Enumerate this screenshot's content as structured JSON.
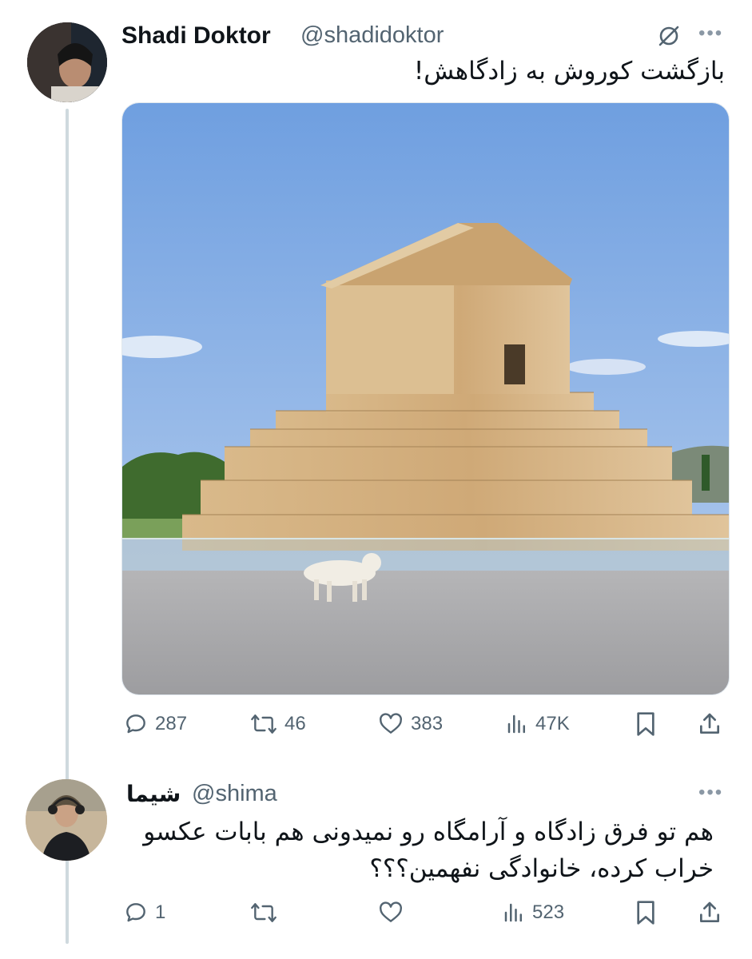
{
  "tweet": {
    "author_name": "Shadi Doktor",
    "author_handle": "@shadidoktor",
    "text": "بازگشت کوروش به زادگاهش!",
    "media_icon": "photo-tomb-of-cyrus",
    "actions": {
      "replies": "287",
      "reposts": "46",
      "likes": "383",
      "views": "47K"
    }
  },
  "reply": {
    "author_name": "شیما",
    "author_handle": "@shima",
    "text_line1": "هم تو فرق زادگاه و آرامگاه رو نمیدونی هم بابات عکسو",
    "text_line2": "خراب کرده، خانوادگی نفهمین؟؟؟",
    "actions": {
      "replies": "1",
      "reposts": "",
      "likes": "",
      "views": "523"
    }
  },
  "colors": {
    "text": "#0f1419",
    "secondary": "#536471",
    "thread_line": "#cfd9de",
    "sky": "#8db3e6"
  }
}
